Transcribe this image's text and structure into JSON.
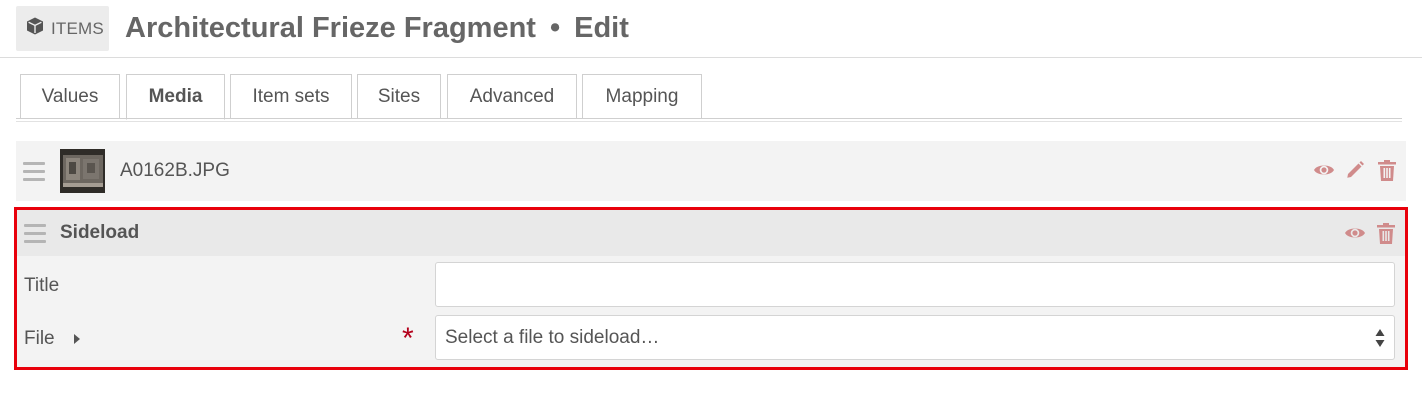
{
  "header": {
    "badge_icon": "cube-icon",
    "badge_label": "ITEMS",
    "item_title": "Architectural Frieze Fragment",
    "separator": "•",
    "mode": "Edit"
  },
  "tabs": [
    {
      "label": "Values",
      "active": false
    },
    {
      "label": "Media",
      "active": true
    },
    {
      "label": "Item sets",
      "active": false
    },
    {
      "label": "Sites",
      "active": false
    },
    {
      "label": "Advanced",
      "active": false
    },
    {
      "label": "Mapping",
      "active": false
    }
  ],
  "media": {
    "filename": "A0162B.JPG",
    "actions": [
      "eye-icon",
      "pencil-icon",
      "trash-icon"
    ]
  },
  "sideload": {
    "heading": "Sideload",
    "actions": [
      "eye-icon",
      "trash-icon"
    ],
    "title_label": "Title",
    "title_value": "",
    "file_label": "File",
    "required_mark": "*",
    "file_placeholder": "Select a file to sideload…"
  },
  "colors": {
    "action_icon": "#d08b8b",
    "highlight_border": "#e8000b",
    "required": "#b3001b"
  }
}
